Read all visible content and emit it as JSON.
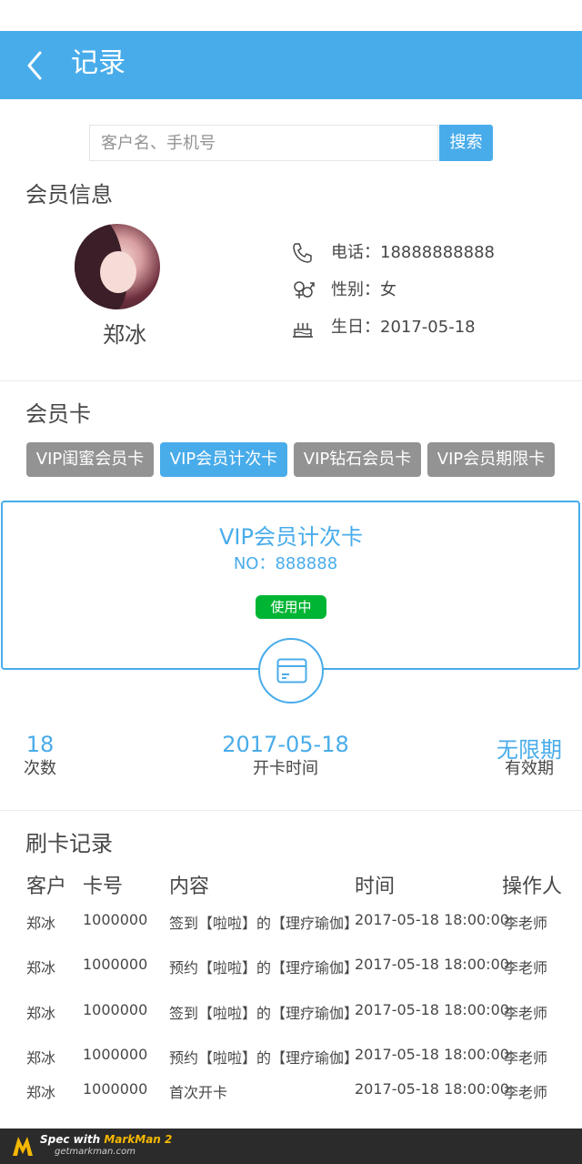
{
  "header": {
    "title": "记录"
  },
  "search": {
    "placeholder": "客户名、手机号",
    "button_label": "搜索"
  },
  "member_info": {
    "section_title": "会员信息",
    "name": "郑冰",
    "phone": "电话：18888888888",
    "gender": "性别：女",
    "birthday": "生日：2017-05-18"
  },
  "member_card": {
    "section_title": "会员卡",
    "tabs": [
      {
        "label": "VIP闺蜜会员卡",
        "active": false
      },
      {
        "label": "VIP会员计次卡",
        "active": true
      },
      {
        "label": "VIP钻石会员卡",
        "active": false
      },
      {
        "label": "VIP会员期限卡",
        "active": false
      }
    ],
    "selected_card": {
      "name": "VIP会员计次卡",
      "number": "NO：888888",
      "status": "使用中"
    },
    "stats": [
      {
        "value": "18",
        "label": "次数"
      },
      {
        "value": "2017-05-18",
        "label": "开卡时间"
      },
      {
        "value": "无限期",
        "label": "有效期"
      }
    ]
  },
  "records": {
    "section_title": "刷卡记录",
    "columns": [
      "客户",
      "卡号",
      "内容",
      "时间",
      "操作人"
    ],
    "rows": [
      [
        "郑冰",
        "1000000",
        "签到【啦啦】的【理疗瑜伽】",
        "2017-05-18 18:00:00",
        "李老师"
      ],
      [
        "郑冰",
        "1000000",
        "预约【啦啦】的【理疗瑜伽】",
        "2017-05-18 18:00:00",
        "李老师"
      ],
      [
        "郑冰",
        "1000000",
        "签到【啦啦】的【理疗瑜伽】",
        "2017-05-18 18:00:00",
        "李老师"
      ],
      [
        "郑冰",
        "1000000",
        "预约【啦啦】的【理疗瑜伽】",
        "2017-05-18 18:00:00",
        "李老师"
      ],
      [
        "郑冰",
        "1000000",
        "首次开卡",
        "2017-05-18 18:00:00",
        "李老师"
      ]
    ]
  },
  "footer": {
    "brand_line": "Spec with ",
    "brand_name": "MarkMan 2",
    "site": "getmarkman.com"
  },
  "colors": {
    "accent": "#49acea",
    "gray_tab": "#939393",
    "status_green": "#01b534",
    "text": "#474747"
  }
}
